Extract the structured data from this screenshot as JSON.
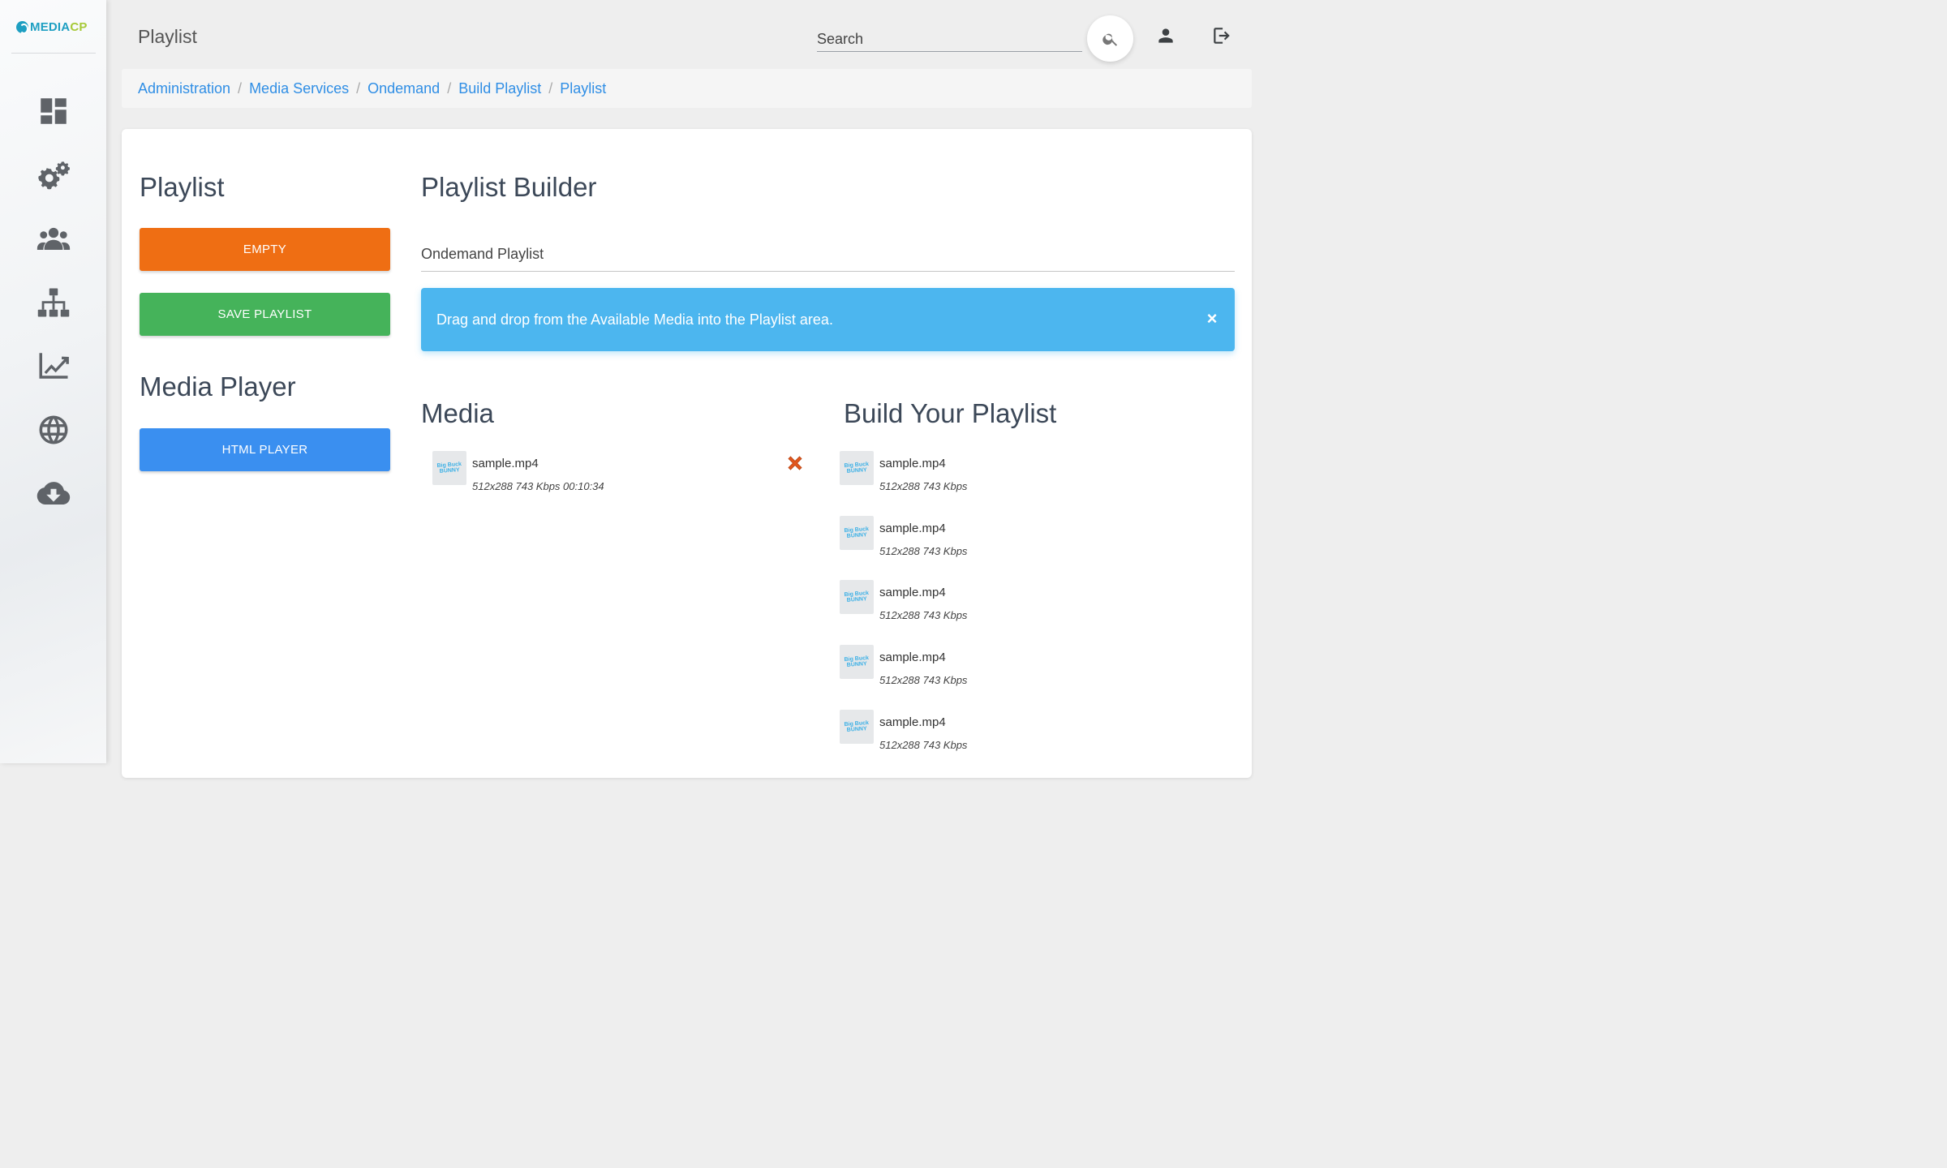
{
  "brand": {
    "part1": "MEDIA",
    "part2": "CP"
  },
  "sidebar": {
    "items": [
      {
        "icon": "dashboard-icon"
      },
      {
        "icon": "settings-icon"
      },
      {
        "icon": "users-icon"
      },
      {
        "icon": "sitemap-icon"
      },
      {
        "icon": "analytics-icon"
      },
      {
        "icon": "globe-icon"
      },
      {
        "icon": "cloud-download-icon"
      }
    ]
  },
  "topbar": {
    "title": "Playlist",
    "search_placeholder": "Search"
  },
  "breadcrumb": [
    "Administration",
    "Media Services",
    "Ondemand",
    "Build Playlist",
    "Playlist"
  ],
  "left": {
    "playlist_heading": "Playlist",
    "empty_label": "EMPTY",
    "save_label": "SAVE PLAYLIST",
    "player_heading": "Media Player",
    "html_player_label": "HTML PLAYER"
  },
  "builder": {
    "heading": "Playlist Builder",
    "playlist_name": "Ondemand Playlist",
    "alert_text": "Drag and drop from the Available Media into the Playlist area.",
    "alert_close": "×",
    "media_heading": "Media",
    "build_heading": "Build Your Playlist",
    "thumb_text": "Big Buck BUNNY",
    "media": [
      {
        "name": "sample.mp4",
        "meta": "512x288 743 Kbps 00:10:34"
      }
    ],
    "playlist": [
      {
        "name": "sample.mp4",
        "meta": "512x288 743 Kbps"
      },
      {
        "name": "sample.mp4",
        "meta": "512x288 743 Kbps"
      },
      {
        "name": "sample.mp4",
        "meta": "512x288 743 Kbps"
      },
      {
        "name": "sample.mp4",
        "meta": "512x288 743 Kbps"
      },
      {
        "name": "sample.mp4",
        "meta": "512x288 743 Kbps"
      }
    ]
  },
  "colors": {
    "accent_link": "#2f8ee5",
    "empty_button": "#ef6e13",
    "save_button": "#45b35a",
    "player_button": "#3a8ff0",
    "alert": "#4cb6ef"
  }
}
